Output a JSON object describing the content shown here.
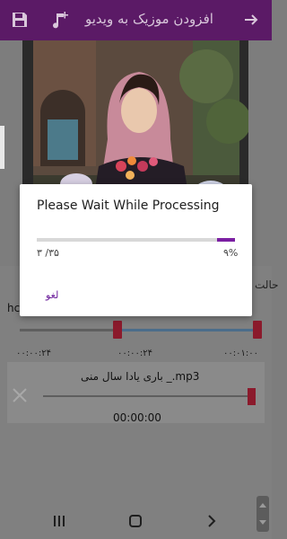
{
  "toolbar": {
    "title": "افزودن موزیک به ویدیو",
    "save_icon": "save-icon",
    "music_icon": "add-music-icon",
    "back_icon": "arrow-right-icon",
    "bg_color": "#5b1a66"
  },
  "background": {
    "partial_label": "حالت",
    "partial_text": "hc"
  },
  "video_trim": {
    "time_left": "۰۰:۰۰:۲۴",
    "time_mid": "۰۰:۰۰:۲۴",
    "time_right": "۰۰:۰۱:۰۰"
  },
  "audio": {
    "name": "باری یادا سال منی _.mp3",
    "time": "00:00:00",
    "remove_icon": "close-icon"
  },
  "dialog": {
    "title": "Please Wait While Processing",
    "count": "۳ /۳۵",
    "percent": "۹%",
    "progress": 0.09,
    "cancel": "لغو",
    "accent": "#7b1fa2"
  },
  "navbar": {
    "recents_icon": "recents-icon",
    "home_icon": "home-icon",
    "back_icon": "back-icon"
  }
}
